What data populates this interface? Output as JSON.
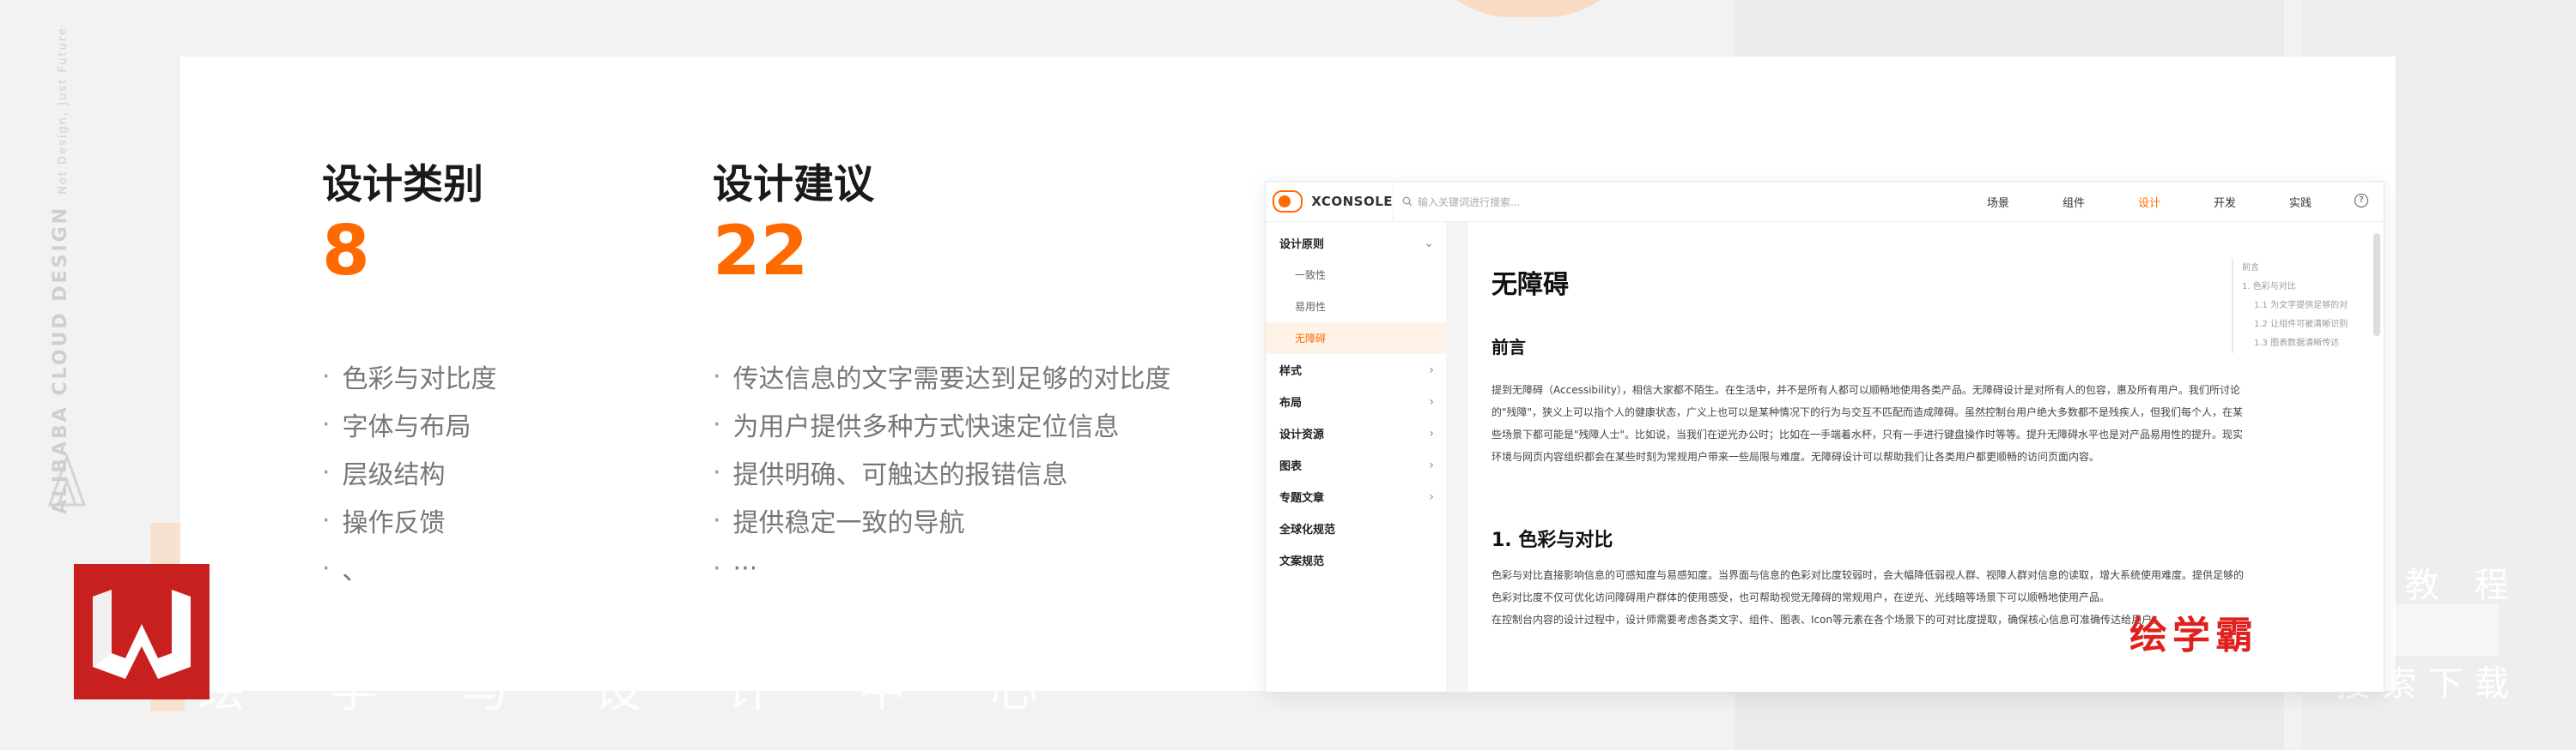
{
  "background": {
    "bottom_text": "绘 学 与 设 计 中 心",
    "right_text_top": "品 教 程",
    "right_text_bottom": "搜索下载",
    "accent_peach": "#fbd2b3"
  },
  "brand_vertical": {
    "main": "ALIBABA CLOUD DESIGN",
    "sub": "Not Design, Just Future"
  },
  "design_categories": {
    "heading": "设计类别",
    "count": "8",
    "items": [
      "色彩与对比度",
      "字体与布局",
      "层级结构",
      "操作反馈",
      "、"
    ]
  },
  "design_suggestions": {
    "heading": "设计建议",
    "count": "22",
    "items": [
      "传达信息的文字需要达到足够的对比度",
      "为用户提供多种方式快速定位信息",
      "提供明确、可触达的报错信息",
      "提供稳定一致的导航",
      "···"
    ]
  },
  "screenshot": {
    "logo_text": "XCONSOLE",
    "search_placeholder": "输入关键词进行搜索...",
    "nav": [
      {
        "label": "场景",
        "active": false
      },
      {
        "label": "组件",
        "active": false
      },
      {
        "label": "设计",
        "active": true
      },
      {
        "label": "开发",
        "active": false
      },
      {
        "label": "实践",
        "active": false
      }
    ],
    "help_icon": "?",
    "sidebar": {
      "group_title": "设计原则",
      "group_items": [
        "一致性",
        "易用性",
        "无障碍"
      ],
      "active_item": "无障碍",
      "sections": [
        "样式",
        "布局",
        "设计资源",
        "图表",
        "专题文章"
      ],
      "plain_items": [
        "全球化规范",
        "文案规范"
      ]
    },
    "article": {
      "title": "无障碍",
      "intro_heading": "前言",
      "intro_text": "提到无障碍（Accessibility），相信大家都不陌生。在生活中，并不是所有人都可以顺畅地使用各类产品。无障碍设计是对所有人的包容，惠及所有用户。我们所讨论的\"残障\"，狭义上可以指个人的健康状态，广义上也可以是某种情况下的行为与交互不匹配而造成障碍。虽然控制台用户绝大多数都不是残疾人，但我们每个人，在某些场景下都可能是\"残障人士\"。比如说，当我们在逆光办公时；比如在一手端着水杯，只有一手进行键盘操作时等等。提升无障碍水平也是对产品易用性的提升。现实环境与网页内容组织都会在某些时刻为常规用户带来一些局限与难度。无障碍设计可以帮助我们让各类用户都更顺畅的访问页面内容。",
      "section1_heading": "1. 色彩与对比",
      "section1_text_a": "色彩与对比直接影响信息的可感知度与易感知度。当界面与信息的色彩对比度较弱时，会大幅降低弱视人群、视障人群对信息的读取，增大系统使用难度。提供足够的色彩对比度不仅可优化访问障碍用户群体的使用感受，也可帮助视觉无障碍的常规用户，在逆光、光线暗等场景下可以顺畅地使用产品。",
      "section1_text_b": "在控制台内容的设计过程中，设计师需要考虑各类文字、组件、图表、Icon等元素在各个场景下的可对比度提取，确保核心信息可准确传达给用户。"
    },
    "toc": {
      "title": "前言",
      "items": [
        "1. 色彩与对比",
        "1.1 为文字提供足够的对",
        "1.2 让组件可被清晰识别",
        "1.3 图表数据清晰传达"
      ]
    }
  },
  "watermark": "绘学霸",
  "redlogo_letter": "W"
}
